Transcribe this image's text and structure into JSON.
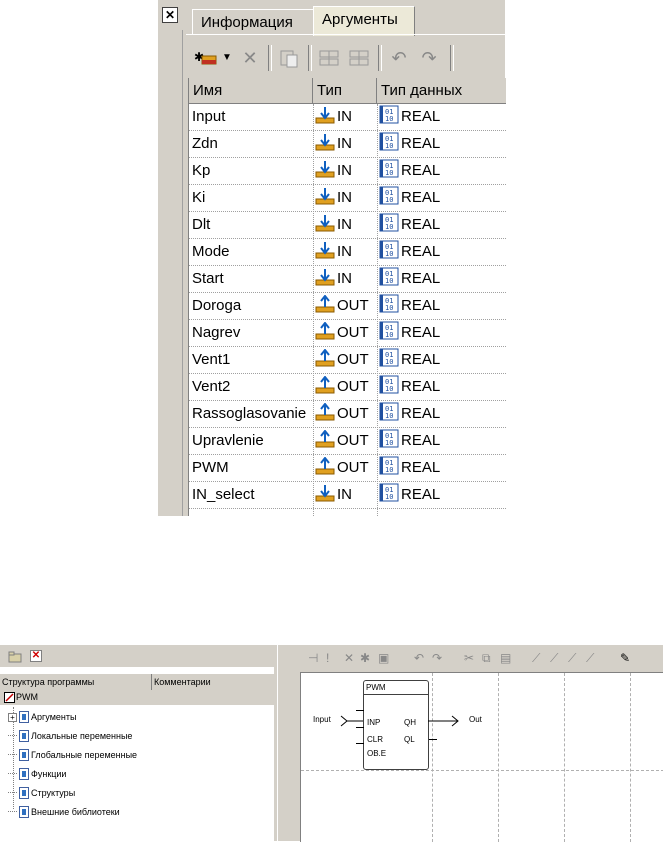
{
  "arguments_panel": {
    "tabs": [
      "Информация",
      "Аргументы"
    ],
    "active_tab": "Аргументы",
    "columns": [
      "Имя",
      "Тип",
      "Тип данных"
    ],
    "rows": [
      {
        "name": "Input",
        "dir": "IN",
        "type": "REAL"
      },
      {
        "name": "Zdn",
        "dir": "IN",
        "type": "REAL"
      },
      {
        "name": "Kp",
        "dir": "IN",
        "type": "REAL"
      },
      {
        "name": "Ki",
        "dir": "IN",
        "type": "REAL"
      },
      {
        "name": "Dlt",
        "dir": "IN",
        "type": "REAL"
      },
      {
        "name": "Mode",
        "dir": "IN",
        "type": "REAL"
      },
      {
        "name": "Start",
        "dir": "IN",
        "type": "REAL"
      },
      {
        "name": "Doroga",
        "dir": "OUT",
        "type": "REAL"
      },
      {
        "name": "Nagrev",
        "dir": "OUT",
        "type": "REAL"
      },
      {
        "name": "Vent1",
        "dir": "OUT",
        "type": "REAL"
      },
      {
        "name": "Vent2",
        "dir": "OUT",
        "type": "REAL"
      },
      {
        "name": "Rassoglasovanie",
        "dir": "OUT",
        "type": "REAL"
      },
      {
        "name": "Upravlenie",
        "dir": "OUT",
        "type": "REAL"
      },
      {
        "name": "PWM",
        "dir": "OUT",
        "type": "REAL"
      },
      {
        "name": "IN_select",
        "dir": "IN",
        "type": "REAL"
      }
    ],
    "colors": {
      "in_arrow": "#1060c0",
      "out_arrow": "#1060c0",
      "tray": "#e0a020",
      "datatype_icon": "#2050a0"
    }
  },
  "structure_panel": {
    "columns": [
      "Структура программы",
      "Комментарии"
    ],
    "root": "PWM",
    "items": [
      "Аргументы",
      "Локальные переменные",
      "Глобальные переменные",
      "Функции",
      "Структуры",
      "Внешние библиотеки"
    ]
  },
  "diagram": {
    "block_title": "PWM",
    "inputs": [
      "INP",
      "CLR",
      "OB.E"
    ],
    "outputs": [
      "QH",
      "QL"
    ],
    "input_label": "Input",
    "output_label": "Out"
  }
}
